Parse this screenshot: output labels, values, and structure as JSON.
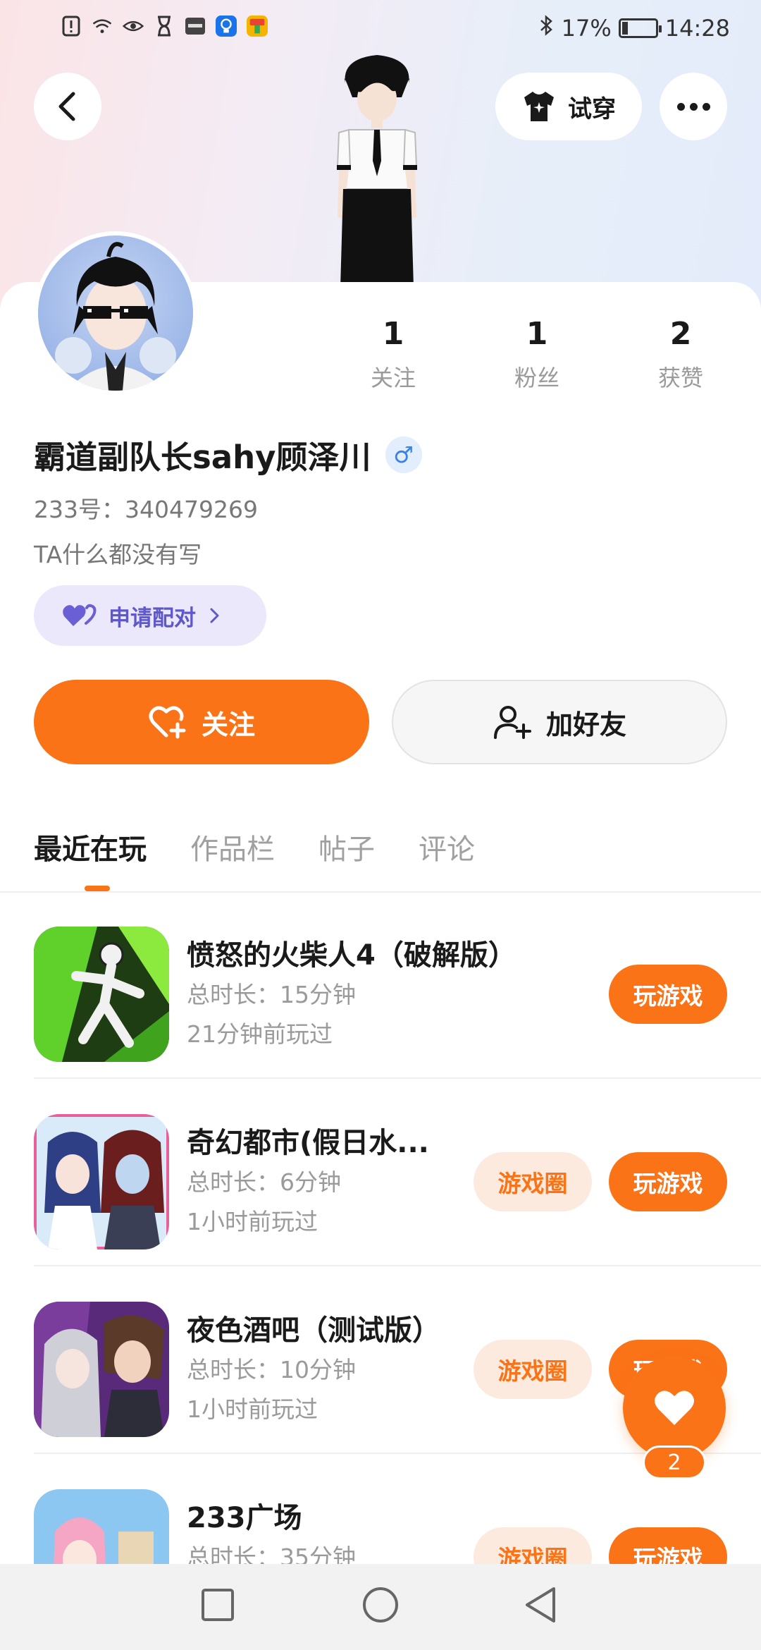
{
  "status_bar": {
    "battery": "17%",
    "battery_level": 0.17,
    "time": "14:28",
    "icons_left": [
      "alert-icon",
      "wifi-icon",
      "eye-icon",
      "hourglass-icon",
      "huawei-icon",
      "lightbulb-icon",
      "app-icon"
    ],
    "icons_right": [
      "bluetooth-icon",
      "battery-icon"
    ]
  },
  "header": {
    "tryon_label": "试穿"
  },
  "profile": {
    "stats": [
      {
        "num": "1",
        "label": "关注"
      },
      {
        "num": "1",
        "label": "粉丝"
      },
      {
        "num": "2",
        "label": "获赞"
      }
    ],
    "username": "霸道副队长sahy顾泽川",
    "gender_symbol": "♂",
    "uid": "233号：340479269",
    "bio": "TA什么都没有写",
    "pair_label": "申请配对"
  },
  "actions": {
    "follow_label": "关注",
    "add_friend_label": "加好友"
  },
  "tabs": [
    {
      "label": "最近在玩",
      "active": true
    },
    {
      "label": "作品栏",
      "active": false
    },
    {
      "label": "帖子",
      "active": false
    },
    {
      "label": "评论",
      "active": false
    }
  ],
  "games": [
    {
      "title": "愤怒的火柴人4（破解版）",
      "duration": "总时长：15分钟",
      "last_played": "21分钟前玩过",
      "has_circle": false
    },
    {
      "title": "奇幻都市(假日水...",
      "duration": "总时长：6分钟",
      "last_played": "1小时前玩过",
      "has_circle": true
    },
    {
      "title": "夜色酒吧（测试版）",
      "duration": "总时长：10分钟",
      "last_played": "1小时前玩过",
      "has_circle": true
    },
    {
      "title": "233广场",
      "duration": "总时长：35分钟",
      "last_played": "",
      "has_circle": true
    }
  ],
  "buttons": {
    "circle_label": "游戏圈",
    "play_label": "玩游戏"
  },
  "fab": {
    "count": "2"
  },
  "colors": {
    "accent": "#fa7316",
    "pair_text": "#5f58c9",
    "pair_bg": "#ebe8fb"
  }
}
